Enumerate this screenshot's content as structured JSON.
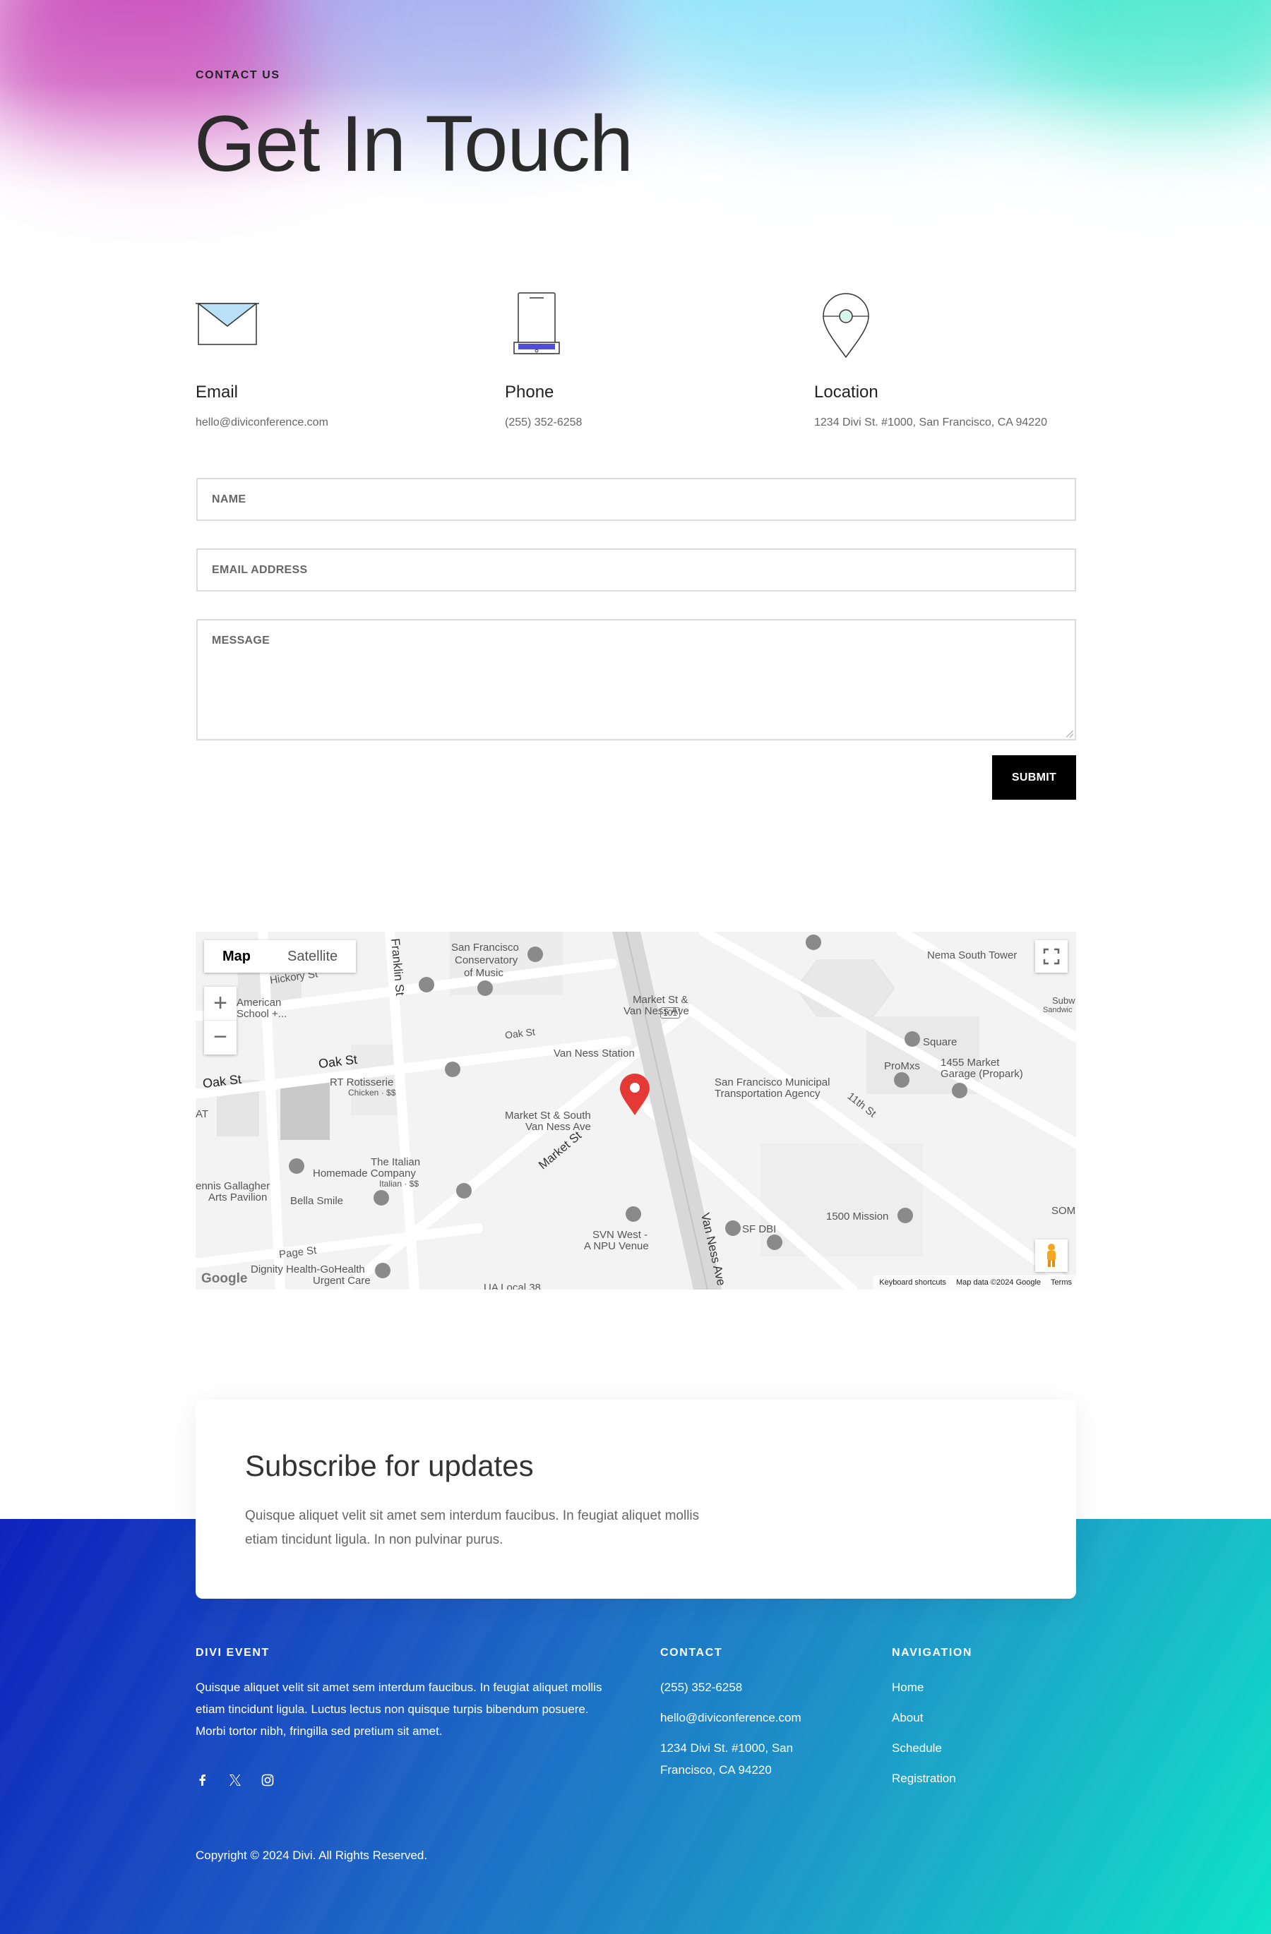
{
  "hero": {
    "eyebrow": "CONTACT US",
    "title": "Get In Touch"
  },
  "contact_info": {
    "email": {
      "label": "Email",
      "value": "hello@diviconference.com",
      "icon": "envelope-icon"
    },
    "phone": {
      "label": "Phone",
      "value": "(255) 352-6258",
      "icon": "smartphone-icon"
    },
    "location": {
      "label": "Location",
      "value": "1234 Divi St. #1000, San Francisco, CA 94220",
      "icon": "map-pin-icon"
    }
  },
  "form": {
    "name_placeholder": "NAME",
    "email_placeholder": "EMAIL ADDRESS",
    "message_placeholder": "MESSAGE",
    "submit_label": "SUBMIT"
  },
  "map": {
    "type_map": "Map",
    "type_satellite": "Satellite",
    "zoom_in": "+",
    "zoom_out": "−",
    "logo": "Google",
    "keyboard_shortcuts": "Keyboard shortcuts",
    "map_data": "Map data ©2024 Google",
    "terms": "Terms",
    "labels": {
      "franklin": "Franklin St",
      "hickory": "Hickory St",
      "conservatory": "San Francisco",
      "conservatory2": "Conservatory",
      "conservatory3": "of Music",
      "nema": "Nema South Tower",
      "american": "American",
      "american2": "School +...",
      "market_van_ness": "Market St &",
      "market_van_ness2": "Van Ness Ave",
      "oak1": "Oak St",
      "oak2": "Oak St",
      "oak3": "Oak St",
      "van_ness_station": "Van Ness Station",
      "square": "Square",
      "hwy": "101",
      "promxs": "ProMxs",
      "garage": "1455 Market",
      "garage2": "Garage (Propark)",
      "rt": "RT Rotisserie",
      "rt2": "Chicken · $$",
      "sfmta": "San Francisco Municipal",
      "sfmta2": "Transportation Agency",
      "eleventh": "11th St",
      "market_south": "Market St & South",
      "market_south2": "Van Ness Ave",
      "market_st": "Market St",
      "italian": "The Italian",
      "italian2": "Homemade Company",
      "italian3": "Italian · $$",
      "gallagher": "ennis Gallagher",
      "gallagher2": "Arts Pavilion",
      "bella": "Bella Smile",
      "page": "Page St",
      "mission": "1500 Mission",
      "sfdbi": "SF DBI",
      "svn": "SVN West -",
      "svn2": "A NPU Venue",
      "van_ness_ave": "Van Ness Ave",
      "dignity": "Dignity Health-GoHealth",
      "dignity2": "Urgent Care",
      "ua": "UA Local 38",
      "som": "SOM",
      "subw": "Subw",
      "sandwich": "Sandwic",
      "at": "AT"
    }
  },
  "subscribe": {
    "title": "Subscribe for updates",
    "text": "Quisque aliquet velit sit amet sem interdum faucibus. In feugiat aliquet mollis etiam tincidunt ligula. In non pulvinar purus."
  },
  "footer": {
    "brand": {
      "title": "DIVI EVENT",
      "text": "Quisque aliquet velit sit amet sem interdum faucibus. In feugiat aliquet mollis etiam tincidunt ligula. Luctus lectus non quisque turpis bibendum posuere. Morbi tortor nibh, fringilla sed pretium sit amet."
    },
    "contact": {
      "title": "CONTACT",
      "phone": "(255) 352-6258",
      "email": "hello@diviconference.com",
      "address": "1234 Divi St. #1000, San Francisco, CA 94220"
    },
    "navigation": {
      "title": "NAVIGATION",
      "items": [
        "Home",
        "About",
        "Schedule",
        "Registration"
      ]
    },
    "social": [
      "facebook-icon",
      "x-icon",
      "instagram-icon"
    ],
    "copyright": "Copyright © 2024 Divi. All Rights Reserved."
  },
  "colors": {
    "footer_start": "#0c20bc",
    "footer_end": "#0ee4c8",
    "submit_bg": "#000000",
    "map_pin": "#e53935"
  }
}
